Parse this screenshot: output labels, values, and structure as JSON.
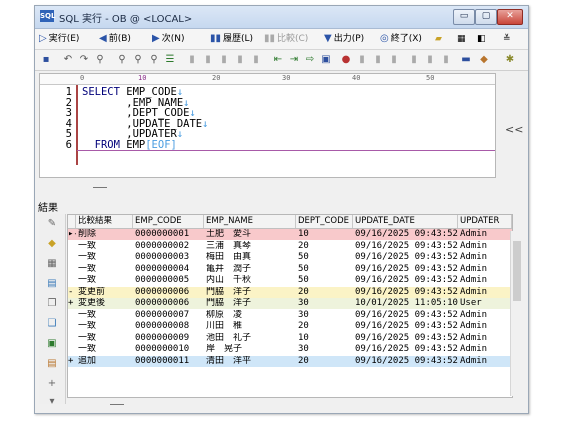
{
  "window": {
    "title": "SQL 実行 - OB @ <LOCAL>",
    "app_icon": "SQL",
    "buttons": [
      "▭",
      "▢",
      "✕"
    ]
  },
  "menu": [
    {
      "icon": "▷",
      "label": "実行(E)"
    },
    {
      "icon": "◀",
      "label": "前(B)"
    },
    {
      "icon": "▶",
      "label": "次(N)"
    },
    {
      "icon": "▮▮",
      "label": "履歴(L)"
    },
    {
      "icon": "▮▮",
      "label": "比較(C)"
    },
    {
      "icon": "▼",
      "label": "出力(P)"
    },
    {
      "icon": "◎",
      "label": "終了(X)"
    }
  ],
  "editor": {
    "lines": [
      {
        "num": "1",
        "keyword": "SELECT",
        "text": " EMP_CODE",
        "eol": "↓"
      },
      {
        "num": "2",
        "keyword": "",
        "text": "       ,EMP_NAME",
        "eol": "↓"
      },
      {
        "num": "3",
        "keyword": "",
        "text": "       ,DEPT_CODE",
        "eol": "↓"
      },
      {
        "num": "4",
        "keyword": "",
        "text": "       ,UPDATE_DATE",
        "eol": "↓"
      },
      {
        "num": "5",
        "keyword": "",
        "text": "       ,UPDATER",
        "eol": "↓"
      },
      {
        "num": "6",
        "keyword": "  FROM",
        "text": " EMP",
        "eol": "[EOF]"
      }
    ],
    "ruler_marks": [
      "0",
      "10",
      "20",
      "30",
      "40",
      "50"
    ],
    "collapse_icon": "<<"
  },
  "results": {
    "label": "結果",
    "columns": [
      "比較結果",
      "EMP_CODE",
      "EMP_NAME",
      "DEPT_CODE",
      "UPDATE_DATE",
      "UPDATER"
    ],
    "rows": [
      {
        "ind": "▸-",
        "cmp": "削除",
        "code": "0000000001",
        "name": "土肥　愛斗",
        "dept": "10",
        "date": "09/16/2025 09:43:52",
        "upd": "Admin",
        "bg": "#f8c9cb"
      },
      {
        "ind": "",
        "cmp": "一致",
        "code": "0000000002",
        "name": "三浦　真琴",
        "dept": "20",
        "date": "09/16/2025 09:43:52",
        "upd": "Admin",
        "bg": "#ffffff"
      },
      {
        "ind": "",
        "cmp": "一致",
        "code": "0000000003",
        "name": "梅田　由真",
        "dept": "50",
        "date": "09/16/2025 09:43:52",
        "upd": "Admin",
        "bg": "#ffffff"
      },
      {
        "ind": "",
        "cmp": "一致",
        "code": "0000000004",
        "name": "亀井　潤子",
        "dept": "50",
        "date": "09/16/2025 09:43:52",
        "upd": "Admin",
        "bg": "#ffffff"
      },
      {
        "ind": "",
        "cmp": "一致",
        "code": "0000000005",
        "name": "内山　千秋",
        "dept": "50",
        "date": "09/16/2025 09:43:52",
        "upd": "Admin",
        "bg": "#ffffff"
      },
      {
        "ind": "-",
        "cmp": "変更前",
        "code": "0000000006",
        "name": "門脇　洋子",
        "dept": "20",
        "date": "09/16/2025 09:43:52",
        "upd": "Admin",
        "bg": "#fbf3c6"
      },
      {
        "ind": "+",
        "cmp": "変更後",
        "code": "0000000006",
        "name": "門脇　洋子",
        "dept": "30",
        "date": "10/01/2025 11:05:10",
        "upd": "User",
        "bg": "#eef3dc"
      },
      {
        "ind": "",
        "cmp": "一致",
        "code": "0000000007",
        "name": "柳原　凌",
        "dept": "30",
        "date": "09/16/2025 09:43:52",
        "upd": "Admin",
        "bg": "#ffffff"
      },
      {
        "ind": "",
        "cmp": "一致",
        "code": "0000000008",
        "name": "川田　稚",
        "dept": "20",
        "date": "09/16/2025 09:43:52",
        "upd": "Admin",
        "bg": "#ffffff"
      },
      {
        "ind": "",
        "cmp": "一致",
        "code": "0000000009",
        "name": "池田　礼子",
        "dept": "10",
        "date": "09/16/2025 09:43:52",
        "upd": "Admin",
        "bg": "#ffffff"
      },
      {
        "ind": "",
        "cmp": "一致",
        "code": "0000000010",
        "name": "岸　晃子",
        "dept": "30",
        "date": "09/16/2025 09:43:52",
        "upd": "Admin",
        "bg": "#ffffff"
      },
      {
        "ind": "+",
        "cmp": "追加",
        "code": "0000000011",
        "name": "清田　洋平",
        "dept": "20",
        "date": "09/16/2025 09:43:52",
        "upd": "Admin",
        "bg": "#cfe6f8"
      }
    ]
  }
}
